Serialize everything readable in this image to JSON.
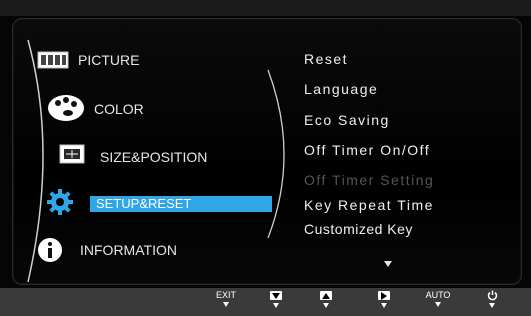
{
  "menu": {
    "items": [
      {
        "label": "PICTURE",
        "icon": "picture-icon",
        "active": false
      },
      {
        "label": "COLOR",
        "icon": "palette-icon",
        "active": false
      },
      {
        "label": "SIZE&POSITION",
        "icon": "size-position-icon",
        "active": false
      },
      {
        "label": "SETUP&RESET",
        "icon": "gear-icon",
        "active": true
      },
      {
        "label": "INFORMATION",
        "icon": "info-icon",
        "active": false
      }
    ]
  },
  "submenu": {
    "items": [
      {
        "label": "Reset",
        "enabled": true
      },
      {
        "label": "Language",
        "enabled": true
      },
      {
        "label": "Eco Saving",
        "enabled": true
      },
      {
        "label": "Off Timer On/Off",
        "enabled": true
      },
      {
        "label": "Off Timer Setting",
        "enabled": false
      },
      {
        "label": "Key Repeat Time",
        "enabled": true
      },
      {
        "label": "Customized Key",
        "enabled": true
      }
    ],
    "more_indicator": "scroll-down-arrow-icon"
  },
  "buttons": [
    {
      "label": "EXIT",
      "icon": "exit-icon"
    },
    {
      "label": "",
      "icon": "down-arrow-key-icon"
    },
    {
      "label": "",
      "icon": "up-arrow-key-icon"
    },
    {
      "label": "",
      "icon": "enter-key-icon"
    },
    {
      "label": "AUTO",
      "icon": "auto-icon"
    },
    {
      "label": "",
      "icon": "power-icon"
    }
  ],
  "colors": {
    "highlight": "#2fa6e8",
    "text": "#e6e6e6",
    "disabled": "#555555",
    "bar": "#3a3a3a"
  }
}
